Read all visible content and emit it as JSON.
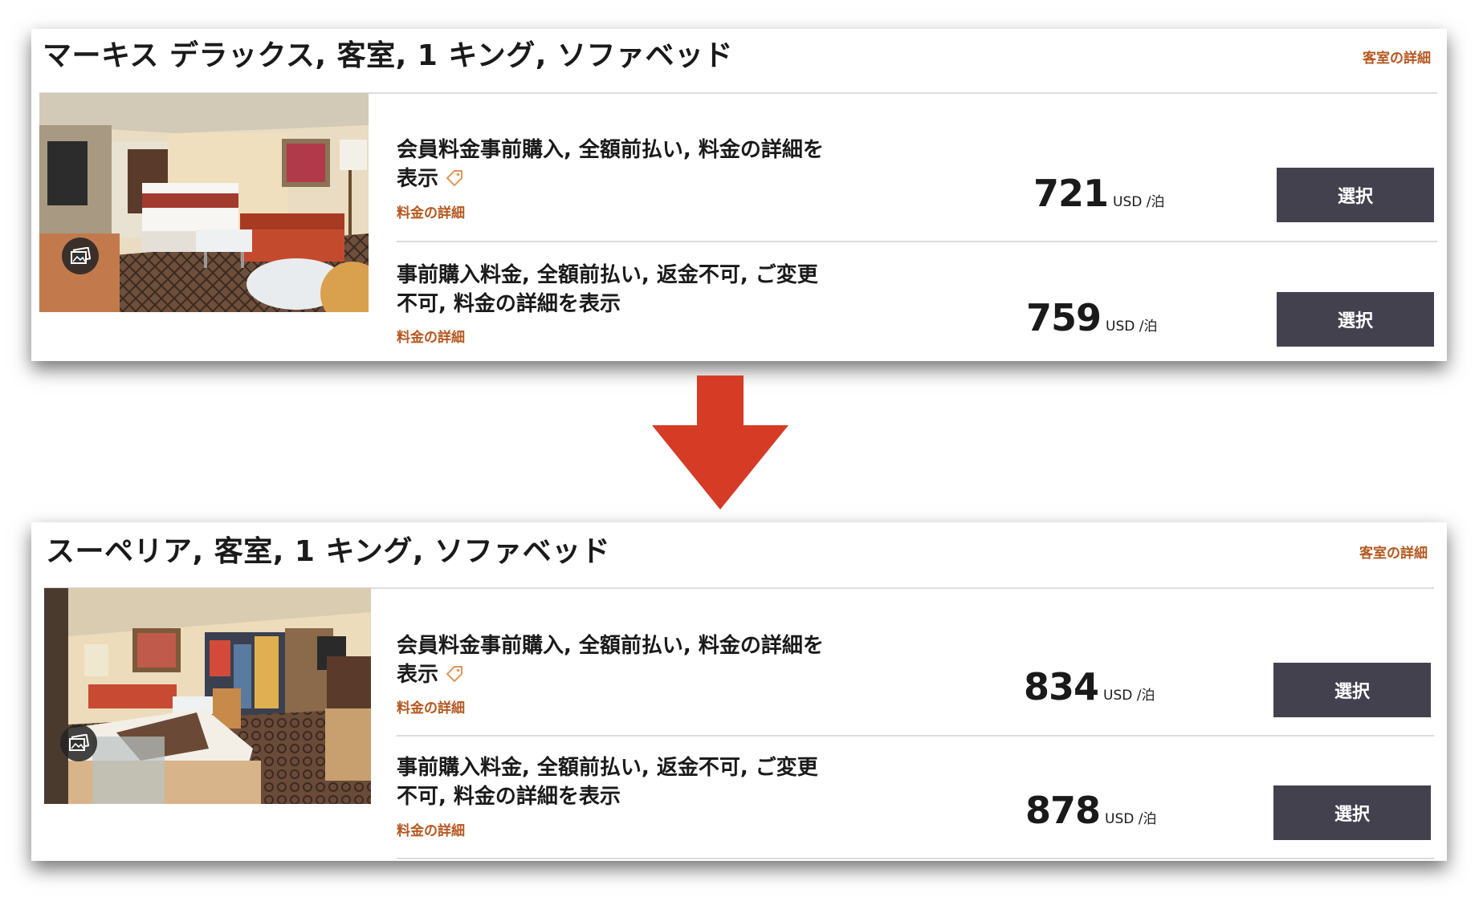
{
  "colors": {
    "accent_link": "#b5571f",
    "select_button_bg": "#44414f",
    "arrow": "#d63b25"
  },
  "rooms": [
    {
      "title": "マーキス デラックス, 客室, 1 キング, ソファベッド",
      "room_details_link": "客室の詳細",
      "gallery_icon": "photo-gallery-icon",
      "rates": [
        {
          "name": "会員料金事前購入, 全額前払い, 料金の詳細を表示",
          "has_member_tag": true,
          "details_link": "料金の詳細",
          "price": "721",
          "unit": "USD /泊",
          "select_label": "選択"
        },
        {
          "name": "事前購入料金, 全額前払い, 返金不可, ご変更不可, 料金の詳細を表示",
          "has_member_tag": false,
          "details_link": "料金の詳細",
          "price": "759",
          "unit": "USD /泊",
          "select_label": "選択"
        }
      ]
    },
    {
      "title": "スーペリア, 客室, 1 キング, ソファベッド",
      "room_details_link": "客室の詳細",
      "gallery_icon": "photo-gallery-icon",
      "rates": [
        {
          "name": "会員料金事前購入, 全額前払い, 料金の詳細を表示",
          "has_member_tag": true,
          "details_link": "料金の詳細",
          "price": "834",
          "unit": "USD /泊",
          "select_label": "選択"
        },
        {
          "name": "事前購入料金, 全額前払い, 返金不可, ご変更不可, 料金の詳細を表示",
          "has_member_tag": false,
          "details_link": "料金の詳細",
          "price": "878",
          "unit": "USD /泊",
          "select_label": "選択"
        }
      ]
    }
  ]
}
